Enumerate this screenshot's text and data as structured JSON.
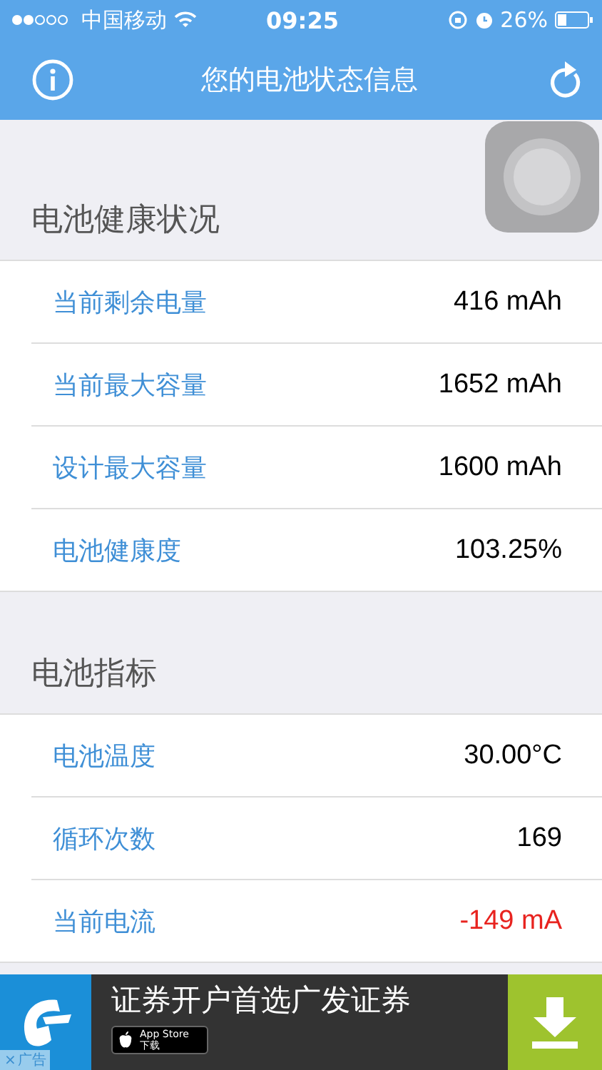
{
  "status_bar": {
    "carrier": "中国移动",
    "time": "09:25",
    "battery": "26%"
  },
  "nav": {
    "title": "您的电池状态信息"
  },
  "sections": [
    {
      "title": "电池健康状况",
      "rows": [
        {
          "label": "当前剩余电量",
          "value": "416 mAh",
          "color": "#000000"
        },
        {
          "label": "当前最大容量",
          "value": "1652 mAh",
          "color": "#000000"
        },
        {
          "label": "设计最大容量",
          "value": "1600 mAh",
          "color": "#000000"
        },
        {
          "label": "电池健康度",
          "value": "103.25%",
          "color": "#000000"
        }
      ]
    },
    {
      "title": "电池指标",
      "rows": [
        {
          "label": "电池温度",
          "value": "30.00°C",
          "color": "#000000"
        },
        {
          "label": "循环次数",
          "value": "169",
          "color": "#000000"
        },
        {
          "label": "当前电流",
          "value": "-149 mA",
          "color": "#e8231f"
        }
      ]
    }
  ],
  "ad": {
    "headline": "证券开户首选广发证券",
    "store": "App Store",
    "store_sub": "下载",
    "close": "×",
    "tag": "广告"
  }
}
